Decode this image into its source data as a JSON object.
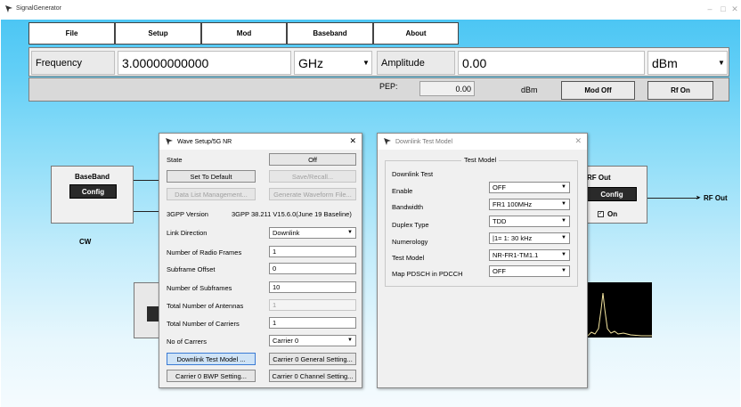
{
  "app": {
    "title": "SignalGenerator",
    "icon": "app-logo-icon",
    "controls": [
      "–",
      "□",
      "✕"
    ]
  },
  "menu": [
    "File",
    "Setup",
    "Mod",
    "Baseband",
    "About"
  ],
  "frequency": {
    "label": "Frequency",
    "value": "3.00000000000",
    "unit": "GHz"
  },
  "amplitude": {
    "label": "Amplitude",
    "value": "0.00",
    "unit": "dBm"
  },
  "pep": {
    "label": "PEP:",
    "value": "0.00",
    "unit": "dBm"
  },
  "buttons": {
    "mod_off": "Mod Off",
    "rf_on": "Rf On"
  },
  "diagram": {
    "baseband": {
      "title": "BaseBand",
      "button": "Config",
      "mode": "CW"
    },
    "rf_out": {
      "title": "RF Out",
      "button": "Config",
      "checkbox_label": "On",
      "checked": true,
      "arrow_label": "RF Out"
    }
  },
  "wave_setup": {
    "title": "Wave Setup/5G NR",
    "close": "✕",
    "state_label": "State",
    "state_button": "Off",
    "set_default": "Set To Default",
    "save_recall": "Save/Recall...",
    "data_list": "Data List Management...",
    "gen_waveform": "Generate Waveform File...",
    "version_label": "3GPP Version",
    "version_value": "3GPP 38.211 V15.6.0(June 19 Baseline)",
    "fields": {
      "link_direction": {
        "label": "Link Direction",
        "value": "Downlink"
      },
      "radio_frames": {
        "label": "Number of Radio Frames",
        "value": "1"
      },
      "subframe_offset": {
        "label": "Subframe Offset",
        "value": "0"
      },
      "num_subframes": {
        "label": "Number of Subframes",
        "value": "10"
      },
      "total_antennas": {
        "label": "Total Number of Antennas",
        "value": "1"
      },
      "total_carriers": {
        "label": "Total Number of Carriers",
        "value": "1"
      },
      "no_carriers": {
        "label": "No of Carrers",
        "value": "Carrier 0"
      }
    },
    "btn_dl_test": "Downlink Test Model ...",
    "btn_carrier_general": "Carrier 0 General Setting...",
    "btn_carrier_bwp": "Carrier 0 BWP Setting...",
    "btn_carrier_channel": "Carrier 0 Channel Setting..."
  },
  "dl_test_model": {
    "title": "Downlink Test Model",
    "close": "✕",
    "group": "Test Model",
    "heading": "Downlink Test",
    "fields": {
      "enable": {
        "label": "Enable",
        "value": "OFF"
      },
      "bandwidth": {
        "label": "Bandwidth",
        "value": "FR1 100MHz"
      },
      "duplex": {
        "label": "Duplex Type",
        "value": "TDD"
      },
      "numerology": {
        "label": "Numerology",
        "value": "|1= 1: 30 kHz"
      },
      "test_model": {
        "label": "Test Model",
        "value": "NR-FR1-TM1.1"
      },
      "map_pdsch": {
        "label": "Map PDSCH in PDCCH",
        "value": "OFF"
      }
    }
  },
  "colors": {
    "bg_top": "#4cc6f4",
    "bg_bottom": "#f5fbfe",
    "dialog": "#f0f0f0",
    "config_btn": "#2a2a2a",
    "selected_btn": "#cfe3f6"
  }
}
